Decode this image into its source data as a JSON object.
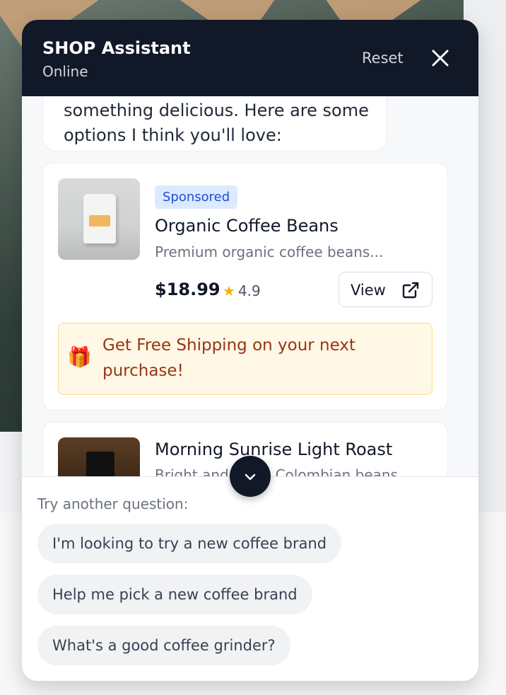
{
  "header": {
    "title": "SHOP Assistant",
    "status": "Online",
    "reset_label": "Reset"
  },
  "chat": {
    "message_line1": "something delicious. Here are some",
    "message_line2": "options I think you'll love:"
  },
  "products": [
    {
      "badge": "Sponsored",
      "name": "Organic Coffee Beans",
      "description": "Premium organic coffee beans...",
      "price": "$18.99",
      "rating": "4.9",
      "view_label": "View",
      "promo_line1": "Get Free Shipping on your next",
      "promo_line2": "purchase!"
    },
    {
      "name": "Morning Sunrise Light Roast",
      "description": "Bright and fruity Colombian beans..."
    }
  ],
  "suggestions": {
    "hint": "Try another question:",
    "items": [
      "I'm looking to try a new coffee brand",
      "Help me pick a new coffee brand",
      "What's a good coffee grinder?"
    ]
  },
  "colors": {
    "header_bg": "#111827",
    "sponsored_bg": "#dbeafe",
    "sponsored_text": "#1d4ed8",
    "promo_bg": "#fff8e6",
    "promo_text": "#9a3412",
    "star": "#f5b301"
  },
  "icons": {
    "close": "close-icon",
    "view": "external-link-icon",
    "scroll": "chevron-down-icon",
    "rating": "star-icon",
    "promo": "gift-icon"
  }
}
